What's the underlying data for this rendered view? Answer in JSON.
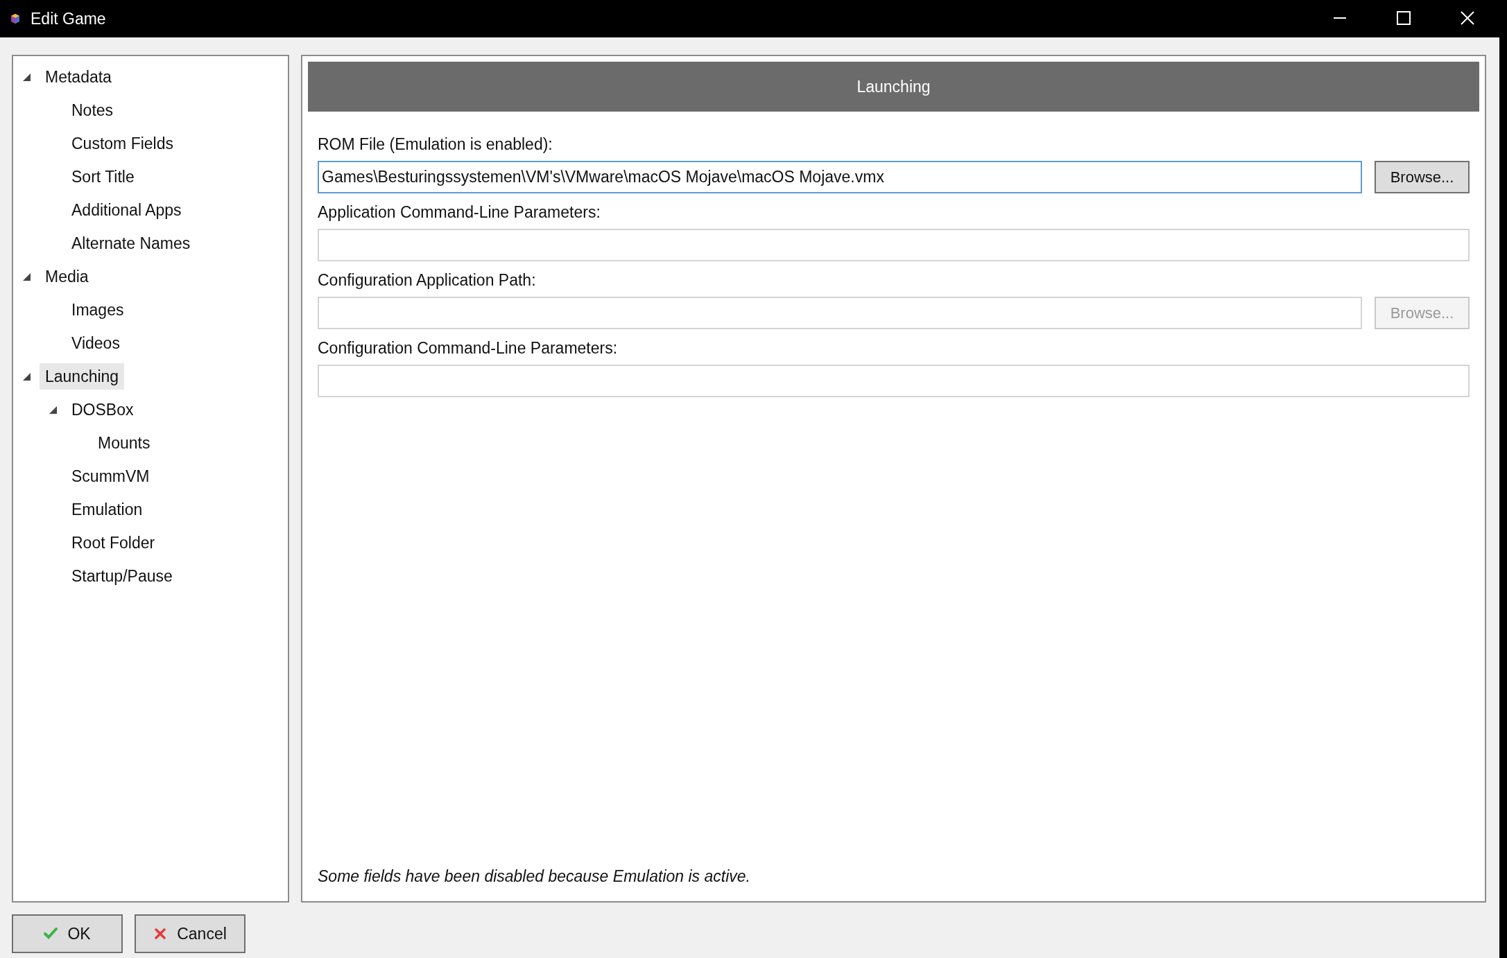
{
  "window": {
    "title": "Edit Game"
  },
  "tree": [
    {
      "label": "Metadata",
      "selected": false,
      "expanded": true,
      "children": [
        {
          "label": "Notes",
          "selected": false
        },
        {
          "label": "Custom Fields",
          "selected": false
        },
        {
          "label": "Sort Title",
          "selected": false
        },
        {
          "label": "Additional Apps",
          "selected": false
        },
        {
          "label": "Alternate Names",
          "selected": false
        }
      ]
    },
    {
      "label": "Media",
      "selected": false,
      "expanded": true,
      "children": [
        {
          "label": "Images",
          "selected": false
        },
        {
          "label": "Videos",
          "selected": false
        }
      ]
    },
    {
      "label": "Launching",
      "selected": true,
      "expanded": true,
      "children": [
        {
          "label": "DOSBox",
          "selected": false,
          "expanded": true,
          "children": [
            {
              "label": "Mounts",
              "selected": false
            }
          ]
        },
        {
          "label": "ScummVM",
          "selected": false
        },
        {
          "label": "Emulation",
          "selected": false
        },
        {
          "label": "Root Folder",
          "selected": false
        },
        {
          "label": "Startup/Pause",
          "selected": false
        }
      ]
    }
  ],
  "panel": {
    "header": "Launching",
    "fields": [
      {
        "label": "ROM File (Emulation is enabled):",
        "value": "Games\\Besturingssystemen\\VM's\\VMware\\macOS Mojave\\macOS Mojave.vmx",
        "focused": true,
        "browse": {
          "label": "Browse...",
          "disabled": false
        }
      },
      {
        "label": "Application Command-Line Parameters:",
        "focused": false
      },
      {
        "label": "Configuration Application Path:",
        "focused": false,
        "browse": {
          "label": "Browse...",
          "disabled": true
        }
      },
      {
        "label": "Configuration Command-Line Parameters:",
        "focused": false
      }
    ],
    "note": "Some fields have been disabled because Emulation is active."
  },
  "buttons": [
    {
      "kind": "ok",
      "label": "OK"
    },
    {
      "kind": "cancel",
      "label": "Cancel"
    }
  ]
}
